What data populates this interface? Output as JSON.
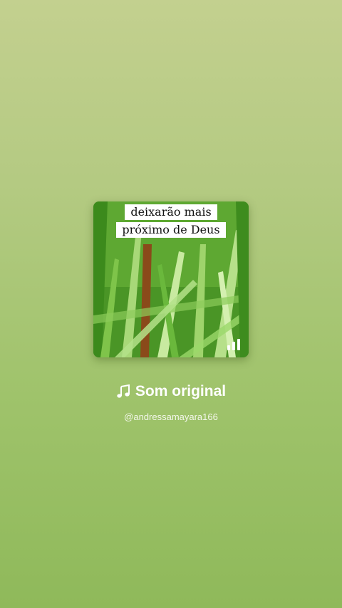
{
  "cover": {
    "caption_line1": "deixarão mais",
    "caption_line2": "próximo de Deus",
    "playing_icon": "equalizer-bars-icon"
  },
  "sound": {
    "icon": "music-note-icon",
    "title": "Som original",
    "author": "@andressamayara166"
  }
}
